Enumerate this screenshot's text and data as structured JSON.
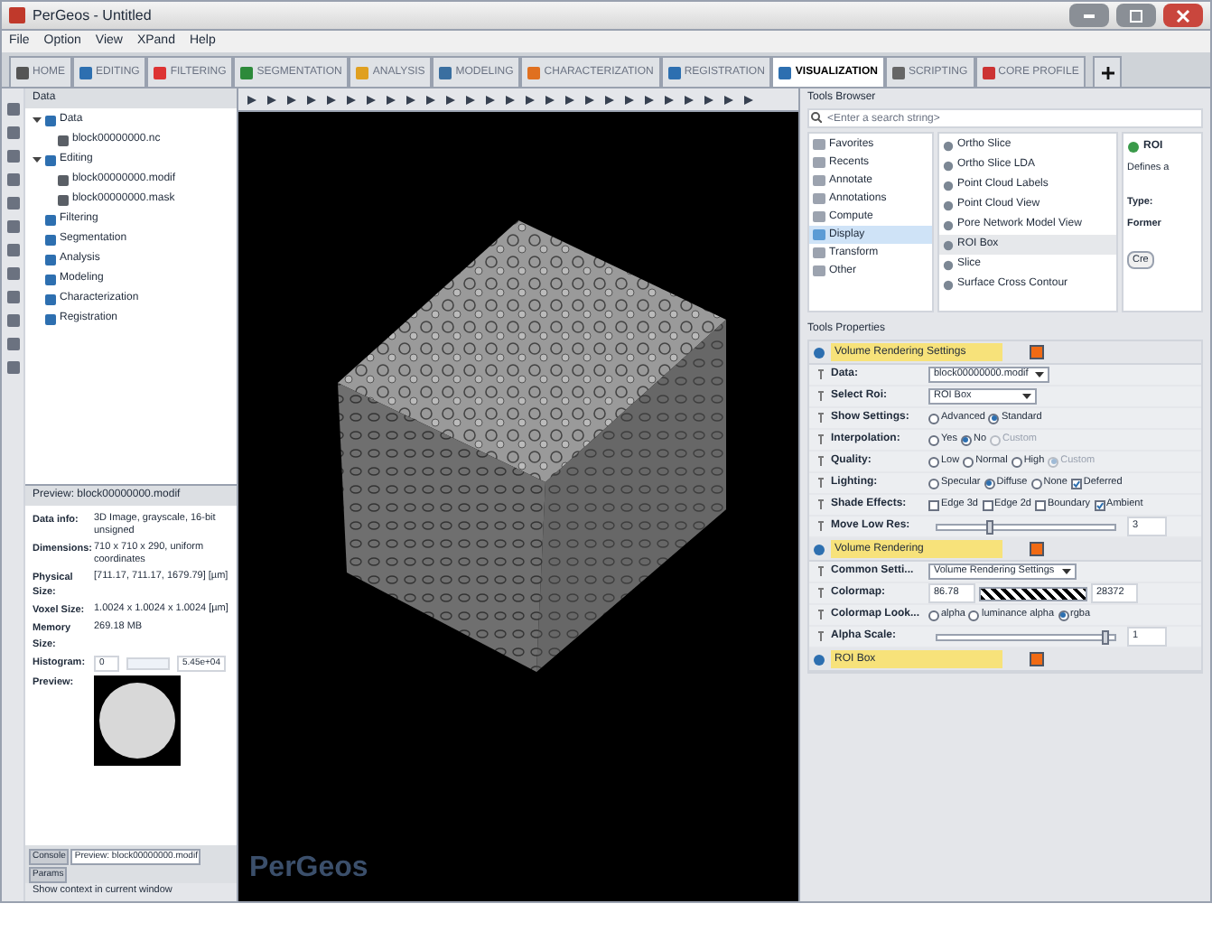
{
  "window": {
    "title": "PerGeos - Untitled"
  },
  "menu": [
    "File",
    "Option",
    "View",
    "XPand",
    "Help"
  ],
  "tabs": [
    {
      "label": "HOME",
      "selected": false
    },
    {
      "label": "EDITING",
      "selected": false
    },
    {
      "label": "FILTERING",
      "selected": false
    },
    {
      "label": "SEGMENTATION",
      "selected": false
    },
    {
      "label": "ANALYSIS",
      "selected": false
    },
    {
      "label": "MODELING",
      "selected": false
    },
    {
      "label": "CHARACTERIZATION",
      "selected": false
    },
    {
      "label": "REGISTRATION",
      "selected": false
    },
    {
      "label": "VISUALIZATION",
      "selected": true
    },
    {
      "label": "SCRIPTING",
      "selected": false
    },
    {
      "label": "CORE PROFILE",
      "selected": false
    }
  ],
  "data_panel": {
    "title": "Data",
    "tree": [
      {
        "label": "Data",
        "expanded": true,
        "children": [
          {
            "label": "block00000000.nc"
          }
        ]
      },
      {
        "label": "Editing",
        "expanded": true,
        "children": [
          {
            "label": "block00000000.modif"
          },
          {
            "label": "block00000000.mask"
          }
        ]
      },
      {
        "label": "Filtering"
      },
      {
        "label": "Segmentation"
      },
      {
        "label": "Analysis"
      },
      {
        "label": "Modeling"
      },
      {
        "label": "Characterization"
      },
      {
        "label": "Registration"
      }
    ]
  },
  "preview_panel": {
    "title": "Preview: block00000000.modif",
    "properties": [
      {
        "label": "Data info:",
        "value": "3D Image, grayscale, 16-bit unsigned"
      },
      {
        "label": "Dimensions:",
        "value": "710 x 710 x 290, uniform coordinates"
      },
      {
        "label": "Physical Size:",
        "value": "[711.17, 711.17, 1679.79] [µm]"
      },
      {
        "label": "Voxel Size:",
        "value": "1.0024 x 1.0024 x 1.0024 [µm]"
      },
      {
        "label": "Memory Size:",
        "value": "269.18 MB"
      }
    ],
    "histogram_label": "Histogram:",
    "histogram_value": "0",
    "histogram_max": "5.45e+04",
    "preview_label": "Preview:"
  },
  "bottom_tabs": [
    {
      "label": "Console",
      "selected": false
    },
    {
      "label": "Preview: block00000000.modif",
      "selected": true
    },
    {
      "label": "Params",
      "selected": false
    }
  ],
  "status_bar": "Show context in current window",
  "viewer": {
    "logo": "PerGeos"
  },
  "tools_browser": {
    "title": "Tools Browser",
    "search": {
      "placeholder": "<Enter a search string>"
    },
    "categories": [
      {
        "label": "Favorites",
        "selected": false
      },
      {
        "label": "Recents",
        "selected": false
      },
      {
        "label": "Annotate",
        "selected": false
      },
      {
        "label": "Annotations",
        "selected": false
      },
      {
        "label": "Compute",
        "selected": false
      },
      {
        "label": "Display",
        "selected": true
      },
      {
        "label": "Transform",
        "selected": false
      },
      {
        "label": "Other",
        "selected": false
      }
    ],
    "tools": [
      {
        "label": "Ortho Slice",
        "selected": false
      },
      {
        "label": "Ortho Slice LDA",
        "selected": false
      },
      {
        "label": "Point Cloud Labels",
        "selected": false
      },
      {
        "label": "Point Cloud View",
        "selected": false
      },
      {
        "label": "Pore Network Model View",
        "selected": false
      },
      {
        "label": "ROI Box",
        "selected": true
      },
      {
        "label": "Slice",
        "selected": false
      },
      {
        "label": "Surface Cross Contour",
        "selected": false
      }
    ],
    "info": {
      "title": "ROI",
      "text": "Defines a",
      "type_label": "Type:",
      "former_label": "Former",
      "button": "Cre"
    }
  },
  "tools_properties": {
    "title": "Tools Properties",
    "modules": [
      {
        "name": "Volume Rendering Settings",
        "ports": [
          {
            "kind": "dropdown",
            "label": "Data:",
            "value": "block00000000.modif"
          },
          {
            "kind": "dropdown",
            "label": "Select Roi:",
            "value": "ROI Box"
          },
          {
            "kind": "options",
            "label": "Show Settings:",
            "options": [
              {
                "kind": "radio",
                "label": "Advanced",
                "selected": false,
                "disabled": false
              },
              {
                "kind": "radio",
                "label": "Standard",
                "selected": true,
                "disabled": false
              }
            ]
          },
          {
            "kind": "options",
            "label": "Interpolation:",
            "options": [
              {
                "kind": "radio",
                "label": "Yes",
                "selected": false,
                "disabled": false
              },
              {
                "kind": "radio",
                "label": "No",
                "selected": true,
                "disabled": false
              },
              {
                "kind": "radio",
                "label": "Custom",
                "selected": false,
                "disabled": true
              }
            ]
          },
          {
            "kind": "options",
            "label": "Quality:",
            "options": [
              {
                "kind": "radio",
                "label": "Low",
                "selected": false,
                "disabled": false
              },
              {
                "kind": "radio",
                "label": "Normal",
                "selected": false,
                "disabled": false
              },
              {
                "kind": "radio",
                "label": "High",
                "selected": false,
                "disabled": false
              },
              {
                "kind": "radio",
                "label": "Custom",
                "selected": true,
                "disabled": true
              }
            ]
          },
          {
            "kind": "options",
            "label": "Lighting:",
            "options": [
              {
                "kind": "radio",
                "label": "Specular",
                "selected": false,
                "disabled": false
              },
              {
                "kind": "radio",
                "label": "Diffuse",
                "selected": true,
                "disabled": false
              },
              {
                "kind": "radio",
                "label": "None",
                "selected": false,
                "disabled": false
              },
              {
                "kind": "check",
                "label": "Deferred",
                "selected": true,
                "disabled": false
              }
            ]
          },
          {
            "kind": "options",
            "label": "Shade Effects:",
            "options": [
              {
                "kind": "check",
                "label": "Edge 3d",
                "selected": false,
                "disabled": false
              },
              {
                "kind": "check",
                "label": "Edge 2d",
                "selected": false,
                "disabled": false
              },
              {
                "kind": "check",
                "label": "Boundary",
                "selected": false,
                "disabled": false
              },
              {
                "kind": "check",
                "label": "Ambient",
                "selected": true,
                "disabled": false
              }
            ]
          },
          {
            "kind": "slider",
            "label": "Move Low Res:",
            "level": 0.3,
            "value": "3"
          }
        ]
      },
      {
        "name": "Volume Rendering",
        "ports": [
          {
            "kind": "dropdown",
            "label": "Common Setti...",
            "value": "Volume Rendering Settings"
          },
          {
            "kind": "colormap",
            "label": "Colormap:",
            "min": "86.78",
            "max": "28372"
          },
          {
            "kind": "options",
            "label": "Colormap Look...",
            "options": [
              {
                "kind": "radio",
                "label": "alpha",
                "selected": false,
                "disabled": false
              },
              {
                "kind": "radio",
                "label": "luminance alpha",
                "selected": false,
                "disabled": false
              },
              {
                "kind": "radio",
                "label": "rgba",
                "selected": true,
                "disabled": false
              }
            ]
          },
          {
            "kind": "slider",
            "label": "Alpha Scale:",
            "level": 0.95,
            "value": "1"
          }
        ]
      },
      {
        "name": "ROI Box"
      }
    ]
  }
}
